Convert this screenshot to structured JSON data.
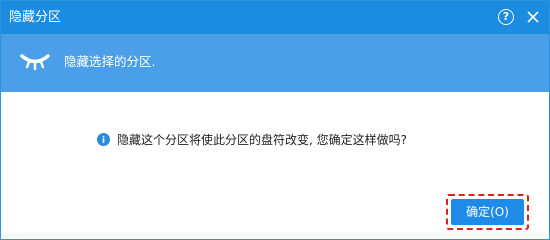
{
  "window": {
    "title": "隐藏分区"
  },
  "titlebar": {
    "help_label": "?",
    "help_icon": "question-circle-icon",
    "close_icon": "close-icon"
  },
  "banner": {
    "icon": "closed-eye-icon",
    "text": "隐藏选择的分区."
  },
  "message": {
    "icon": "info-icon",
    "text": "隐藏这个分区将使此分区的盘符改变, 您确定这样做吗?"
  },
  "buttons": {
    "ok_label": "确定(O)"
  },
  "colors": {
    "titlebar": "#1b8ce0",
    "banner": "#4a9fe8",
    "button": "#1e8be6",
    "highlight": "#e0201a"
  }
}
